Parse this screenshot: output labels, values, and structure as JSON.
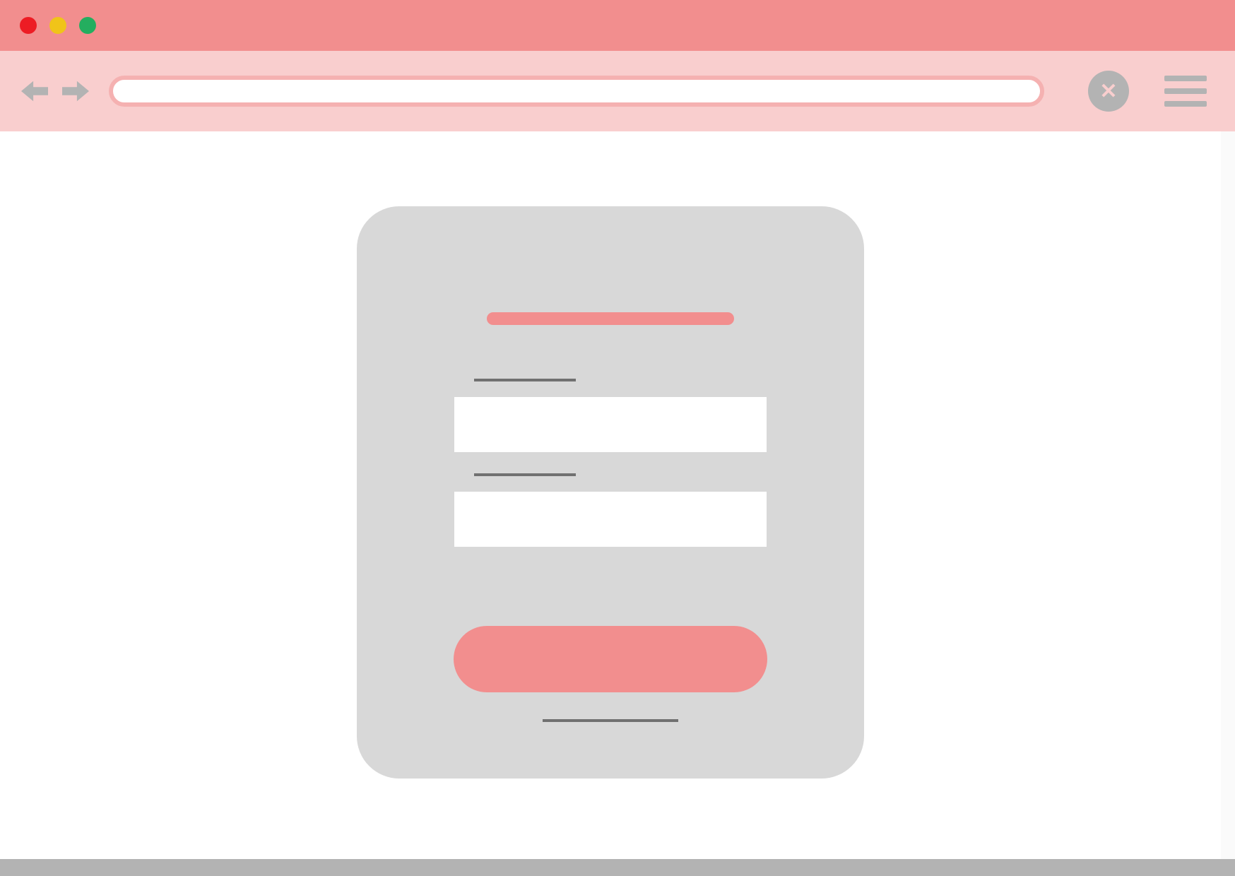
{
  "window": {
    "traffic_lights": [
      "close",
      "minimize",
      "maximize"
    ]
  },
  "nav": {
    "back": "",
    "forward": "",
    "url": "",
    "close": "✕",
    "menu": ""
  },
  "form": {
    "title": "",
    "field1_label": "",
    "field1_value": "",
    "field2_label": "",
    "field2_value": "",
    "submit_label": "",
    "footer_link": ""
  }
}
